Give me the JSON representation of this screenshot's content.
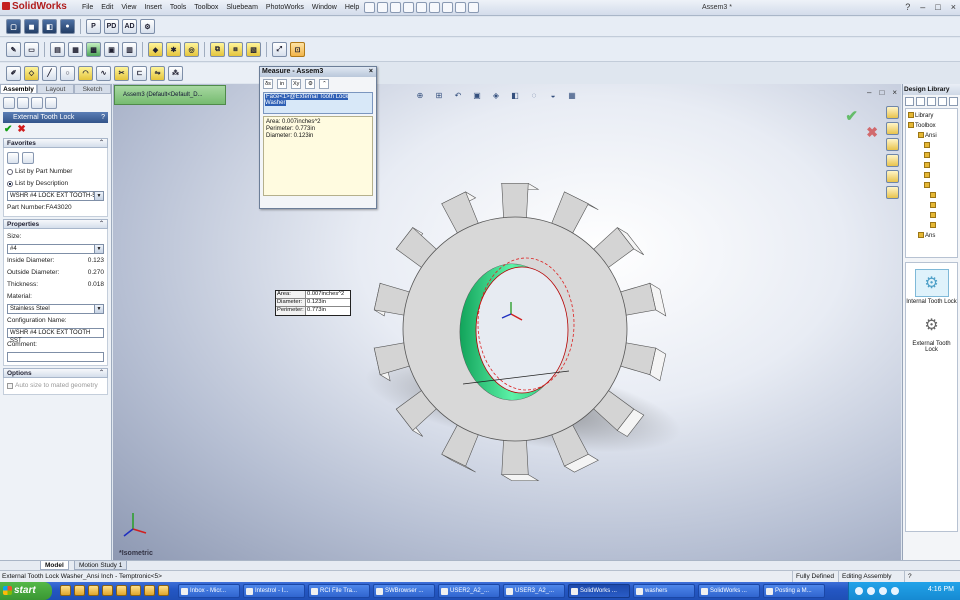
{
  "app": {
    "logo_text": "SolidWorks",
    "menu": [
      "File",
      "Edit",
      "View",
      "Insert",
      "Tools",
      "Toolbox",
      "Sluebeam",
      "PhotoWorks",
      "Window",
      "Help"
    ],
    "doc_title": "Assem3 *",
    "win_controls": [
      "?",
      "–",
      "□",
      "×"
    ]
  },
  "toolbar1": {
    "buttons": [
      "P",
      "PD",
      "AD"
    ]
  },
  "left_panel": {
    "tabs": [
      "Assembly",
      "Layout",
      "Sketch"
    ],
    "property_manager_title": "External Tooth Lock",
    "help_label": "?",
    "ok_icon": "check-icon",
    "cancel_icon": "x-icon",
    "favorites": {
      "header": "Favorites",
      "radio_list_by_part": "List by Part Number",
      "radio_list_by_desc": "List by Description",
      "selected_description": "WSHR #4 LOCK EXT TOOTH-5",
      "part_number_label": "Part Number:FA43020"
    },
    "properties": {
      "header": "Properties",
      "size_label": "Size:",
      "size_value": "#4",
      "inside_diameter_label": "Inside Diameter:",
      "inside_diameter_value": "0.123",
      "outside_diameter_label": "Outside Diameter:",
      "outside_diameter_value": "0.270",
      "thickness_label": "Thickness:",
      "thickness_value": "0.018",
      "material_label": "Material:",
      "material_value": "Stainless Steel",
      "config_label": "Configuration Name:",
      "config_value": "WSHR #4 LOCK EXT TOOTH SST",
      "comment_label": "Comment:",
      "comment_value": ""
    },
    "options": {
      "header": "Options",
      "auto_size_label": "Auto size to mated geometry"
    }
  },
  "viewport": {
    "tree_flyout": "Assem3 (Default<Default_D...",
    "view_label": "*Isometric",
    "callout": [
      {
        "key": "Area:",
        "value": "0.007inches^2"
      },
      {
        "key": "Diameter:",
        "value": "0.123in"
      },
      {
        "key": "Perimeter:",
        "value": "0.773in"
      }
    ]
  },
  "measure": {
    "title": "Measure - Assem3",
    "close": "×",
    "tool_labels": [
      "δs",
      "in",
      "Xy",
      "⚙",
      "⌃"
    ],
    "selection": "Face<1>@External Tooth Lock Washer",
    "results": [
      "Area: 0.007inches^2",
      "Perimeter: 0.773in",
      "Diameter: 0.123in"
    ]
  },
  "design_library": {
    "title": "Design Library",
    "tree": [
      "Library",
      "Toolbox",
      "Ansi",
      "",
      "",
      "",
      "",
      "",
      "",
      "",
      "",
      "",
      "Ans"
    ],
    "items": [
      "Internal Tooth Lock",
      "External Tooth Lock"
    ]
  },
  "bottom_tabs": [
    "Model",
    "Motion Study 1"
  ],
  "status": {
    "left": "External Tooth Lock Washer_Ansi Inch - Temptronic<5>",
    "state": "Fully Defined",
    "mode": "Editing Assembly",
    "help": "?"
  },
  "taskbar": {
    "start": "start",
    "tasks": [
      "Inbox - Micr...",
      "Intestrol - I...",
      "RCI File Tra...",
      "SWBrowser ...",
      "USER2_A2_...",
      "USER3_A2_...",
      "SolidWorks ...",
      "washers",
      "SolidWorks ...",
      "Posting a M...",
      "#4-post-che..."
    ],
    "clock": "4:16 PM"
  },
  "colors": {
    "accent": "#33548a",
    "face_selected": "#2bd47f",
    "ok": "#12a012",
    "cancel": "#d11b1b",
    "taskbar": "#2457c4",
    "start": "#3a9633"
  }
}
